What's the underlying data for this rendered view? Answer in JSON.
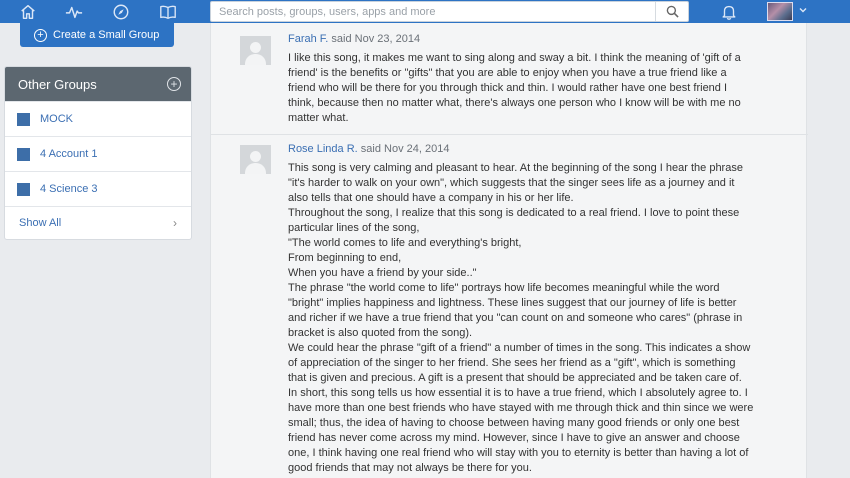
{
  "nav": {
    "icons": [
      "home-icon",
      "activity-icon",
      "compass-icon",
      "book-icon",
      "bell-icon"
    ],
    "search_placeholder": "Search posts, groups, users, apps and more"
  },
  "sidebar": {
    "create_label": "Create a Small Group",
    "groups_title": "Other Groups",
    "groups": [
      {
        "label": "MOCK"
      },
      {
        "label": "4 Account 1"
      },
      {
        "label": "4 Science 3"
      }
    ],
    "show_all": "Show All"
  },
  "posts": [
    {
      "author": "Farah F.",
      "said": "said Nov 23, 2014",
      "lines": [
        "I like this song, it makes me want to sing along and sway a bit. I think the meaning of 'gift of a",
        "friend' is the benefits or \"gifts\" that you are able to enjoy when you have a true friend like a",
        "friend who will be there for you through thick and thin. I would rather have one best friend I",
        "think, because then no matter what, there's always one person who I know will be with me no",
        "matter what."
      ]
    },
    {
      "author": "Rose Linda R.",
      "said": "said Nov 24, 2014",
      "lines": [
        "This song is very calming and pleasant to hear. At the beginning of the song I hear the phrase",
        "\"it's harder to walk on your own\", which suggests that the singer sees life as a journey and it",
        "also tells that one should have a company in his or her life.",
        "Throughout the song, I realize that this song is dedicated to a real friend. I love to point these",
        "particular lines of the song,",
        "\"The world comes to life and everything's bright,",
        "From beginning to end,",
        "When you have a friend by your side..\"",
        "The phrase \"the world come to life\" portrays how life becomes meaningful while the word",
        "\"bright\" implies happiness and lightness. These lines suggest that our journey of life is better",
        "and richer if we have a true friend that you \"can count on and someone who cares\" (phrase in",
        "bracket is also quoted from the song).",
        "We could hear the phrase \"gift of a friend\" a number of times in the song. This indicates a show",
        "of appreciation of the singer to her friend. She sees her friend as a \"gift\", which is something",
        "that is given and precious. A gift is a present that should be appreciated and be taken care of.",
        "In short, this song tells us how essential it is to have a true friend, which I absolutely agree to. I",
        "have more than one best friends who have stayed with me through thick and thin since we were",
        "small; thus, the idea of having to choose between having many good friends or only one best",
        "friend has never come across my mind. However, since I have to give an answer and choose",
        "one, I think having one real friend who will stay with you to eternity is better than having a lot of",
        "good friends that may not always be there for you."
      ]
    }
  ]
}
